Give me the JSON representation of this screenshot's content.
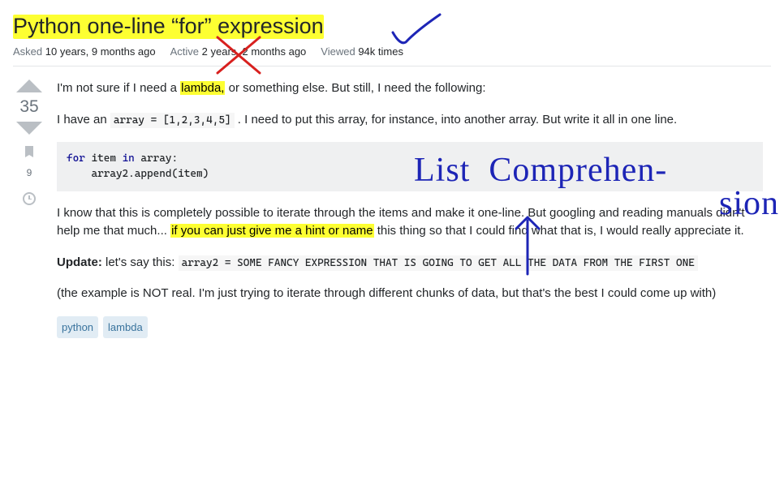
{
  "header": {
    "title": "Python one-line “for” expression",
    "asked_label": "Asked",
    "asked_value": "10 years, 9 months ago",
    "active_label": "Active",
    "active_value": "2 years, 2 months ago",
    "viewed_label": "Viewed",
    "viewed_value": "94k times"
  },
  "vote": {
    "score": "35",
    "bookmark_count": "9"
  },
  "question": {
    "p1_before": "I'm not sure if I need a ",
    "p1_hl": "lambda,",
    "p1_after": " or something else. But still, I need the following:",
    "p2_before": "I have an ",
    "p2_code": "array = [1,2,3,4,5]",
    "p2_after": " . I need to put this array, for instance, into another array. But write it all in one line.",
    "code_kw_for": "for",
    "code_item_in": " item ",
    "code_kw_in": "in",
    "code_line1_rest": " array:",
    "code_line2": "    array2.append(item)",
    "p3_before": "I know that this is completely possible to iterate through the items and make it one-line. But googling and reading manuals didn't help me that much... ",
    "p3_hl": "if you can just give me a hint or name",
    "p3_after": " this thing so that I could find what that is, I would really appreciate it.",
    "update_label": "Update:",
    "update_text": " let's say this: ",
    "update_code": "array2 = SOME FANCY EXPRESSION THAT IS GOING TO GET ALL THE DATA FROM THE FIRST ONE",
    "p5": "(the example is NOT real. I'm just trying to iterate through different chunks of data, but that's the best I could come up with)"
  },
  "tags": [
    "python",
    "lambda"
  ],
  "annotations": {
    "handwriting": "List Comprehension"
  }
}
